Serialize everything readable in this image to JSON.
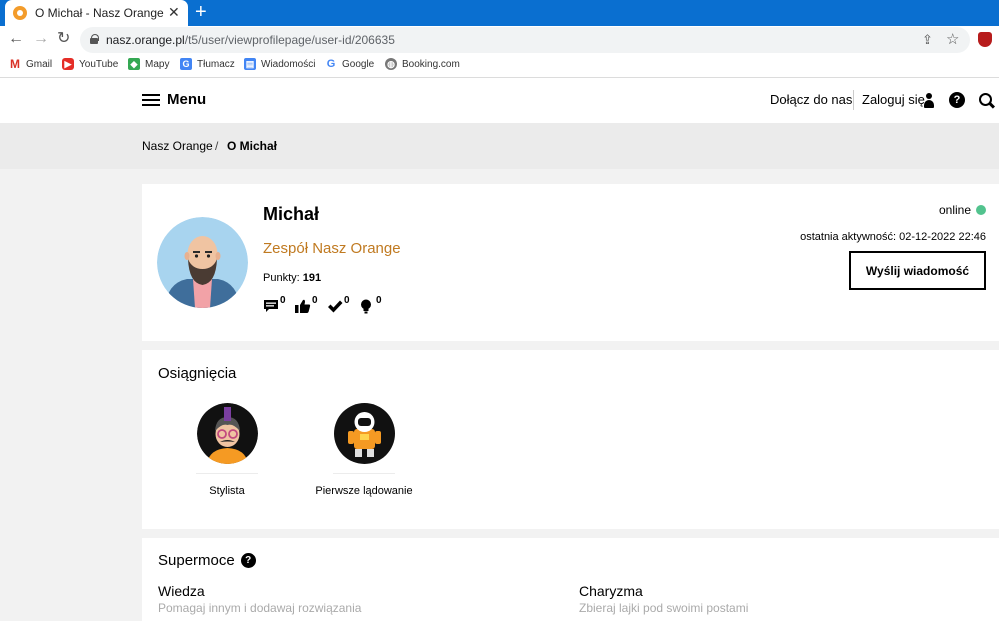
{
  "browser": {
    "tab_title": "O Michał - Nasz Orange",
    "url_host": "nasz.orange.pl",
    "url_path": "/t5/user/viewprofilepage/user-id/206635",
    "bookmarks": [
      "Gmail",
      "YouTube",
      "Mapy",
      "Tłumacz",
      "Wiadomości",
      "Google",
      "Booking.com"
    ]
  },
  "header": {
    "menu_label": "Menu",
    "join_label": "Dołącz do nas",
    "login_label": "Zaloguj się"
  },
  "breadcrumb": {
    "home": "Nasz Orange",
    "separator": "/",
    "current": "O Michał"
  },
  "profile": {
    "name": "Michał",
    "team": "Zespół Nasz Orange",
    "points_label": "Punkty:",
    "points_value": "191",
    "stats": [
      {
        "icon": "comment-icon",
        "count": "0"
      },
      {
        "icon": "thumbs-up-icon",
        "count": "0"
      },
      {
        "icon": "checkmark-icon",
        "count": "0"
      },
      {
        "icon": "lightbulb-icon",
        "count": "0"
      }
    ],
    "status": "online",
    "last_activity": "ostatnia aktywność: 02-12-2022 22:46",
    "send_message_label": "Wyślij wiadomość"
  },
  "achievements": {
    "title": "Osiągnięcia",
    "items": [
      {
        "label": "Stylista",
        "icon": "stylist-badge-icon"
      },
      {
        "label": "Pierwsze lądowanie",
        "icon": "astronaut-badge-icon"
      }
    ]
  },
  "superpowers": {
    "title": "Supermoce",
    "items": [
      {
        "name": "Wiedza",
        "description": "Pomagaj innym i dodawaj rozwiązania"
      },
      {
        "name": "Charyzma",
        "description": "Zbieraj lajki pod swoimi postami"
      }
    ]
  },
  "colors": {
    "tab_bar": "#0a6fd0",
    "team_text": "#c07a21",
    "online_dot": "#52c38e"
  }
}
